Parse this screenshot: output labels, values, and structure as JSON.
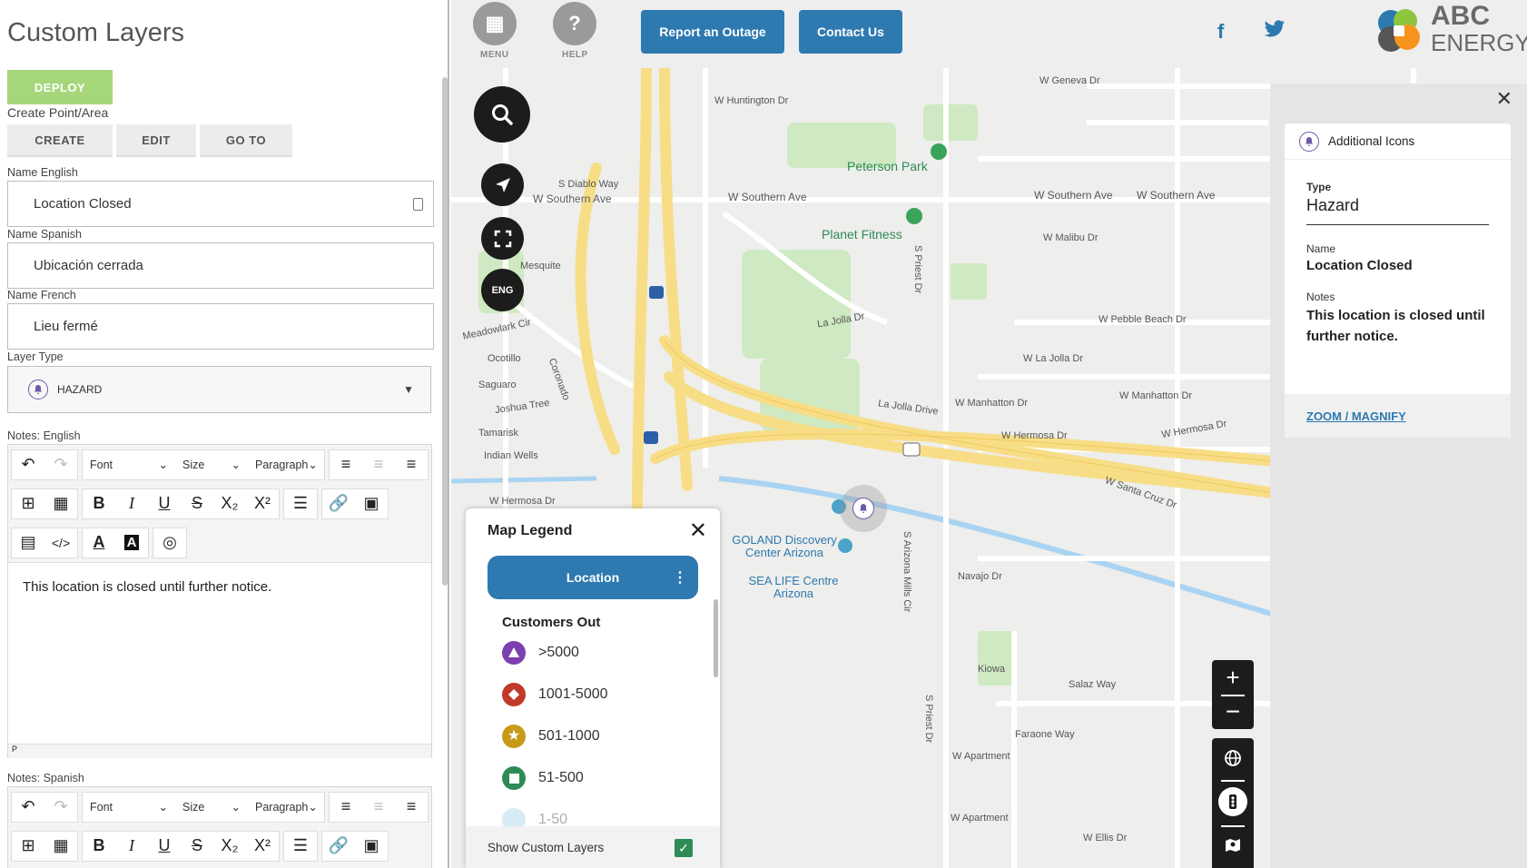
{
  "left_panel": {
    "title": "Custom Layers",
    "deploy_label": "DEPLOY",
    "section_label": "Create Point/Area",
    "tabs": [
      "CREATE",
      "EDIT",
      "GO TO"
    ],
    "name_english_label": "Name English",
    "name_english_value": "Location Closed",
    "name_spanish_label": "Name Spanish",
    "name_spanish_value": "Ubicación cerrada",
    "name_french_label": "Name French",
    "name_french_value": "Lieu fermé",
    "layer_type_label": "Layer Type",
    "layer_type_value": "HAZARD",
    "notes_english_label": "Notes: English",
    "notes_english_value": "This location is closed until further notice.",
    "notes_spanish_label": "Notes: Spanish",
    "editor": {
      "font": "Font",
      "size": "Size",
      "paragraph": "Paragraph",
      "path": "P"
    }
  },
  "topbar": {
    "menu_label": "MENU",
    "help_label": "HELP",
    "outage_button": "Report an Outage",
    "contact_button": "Contact Us",
    "brand_line1": "ABC",
    "brand_line2": "ENERGY",
    "colors": {
      "primary": "#2d79b0",
      "deploy": "#a6d67a"
    }
  },
  "map_controls": {
    "language": "ENG"
  },
  "map_labels": {
    "streets": [
      "W Geneva Dr",
      "W Huntington Dr",
      "W Southern Ave",
      "W Southern Ave",
      "W Southern Ave",
      "W Southern Ave",
      "S Diablo Way",
      "Mesquite",
      "Meadowlark Cir",
      "Ocotillo",
      "Saguaro",
      "Joshua Tree",
      "Tamarisk",
      "Indian Wells",
      "W Hermosa Dr",
      "W Malibu Dr",
      "W Pebble Beach Dr",
      "W La Jolla Dr",
      "La Jolla Dr",
      "La Jolla Drive",
      "W Manhatton Dr",
      "W Manhatton Dr",
      "W Hermosa Dr",
      "W Hermosa Dr",
      "W Santa Cruz Dr",
      "Navajo Dr",
      "Kiowa",
      "Salaz Way",
      "Faraone Way",
      "W Apartment",
      "W Apartment",
      "W Ellis Dr",
      "S Priest Dr",
      "S Priest Dr",
      "Coronado",
      "S Arizona Mills Cir"
    ],
    "places": [
      "Peterson Park",
      "Planet Fitness",
      "GOLAND Discovery Center Arizona",
      "SEA LIFE Centre Arizona"
    ]
  },
  "legend": {
    "title": "Map Legend",
    "location_button": "Location",
    "section": "Customers Out",
    "items": [
      {
        "label": ">5000",
        "color": "#7b3fb0",
        "icon": "triangle-icon"
      },
      {
        "label": "1001-5000",
        "color": "#c0392b",
        "icon": "diamond-icon"
      },
      {
        "label": "501-1000",
        "color": "#c79a1a",
        "icon": "star-icon"
      },
      {
        "label": "51-500",
        "color": "#2e8b57",
        "icon": "square-icon"
      },
      {
        "label": "1-50",
        "color": "#9ccbe8",
        "icon": "circle-icon"
      }
    ],
    "show_custom_layers": "Show Custom Layers"
  },
  "detail_panel": {
    "header": "Additional Icons",
    "type_label": "Type",
    "type_value": "Hazard",
    "name_label": "Name",
    "name_value": "Location Closed",
    "notes_label": "Notes",
    "notes_value": "This location is closed until further notice.",
    "zoom_link": "ZOOM / MAGNIFY"
  }
}
